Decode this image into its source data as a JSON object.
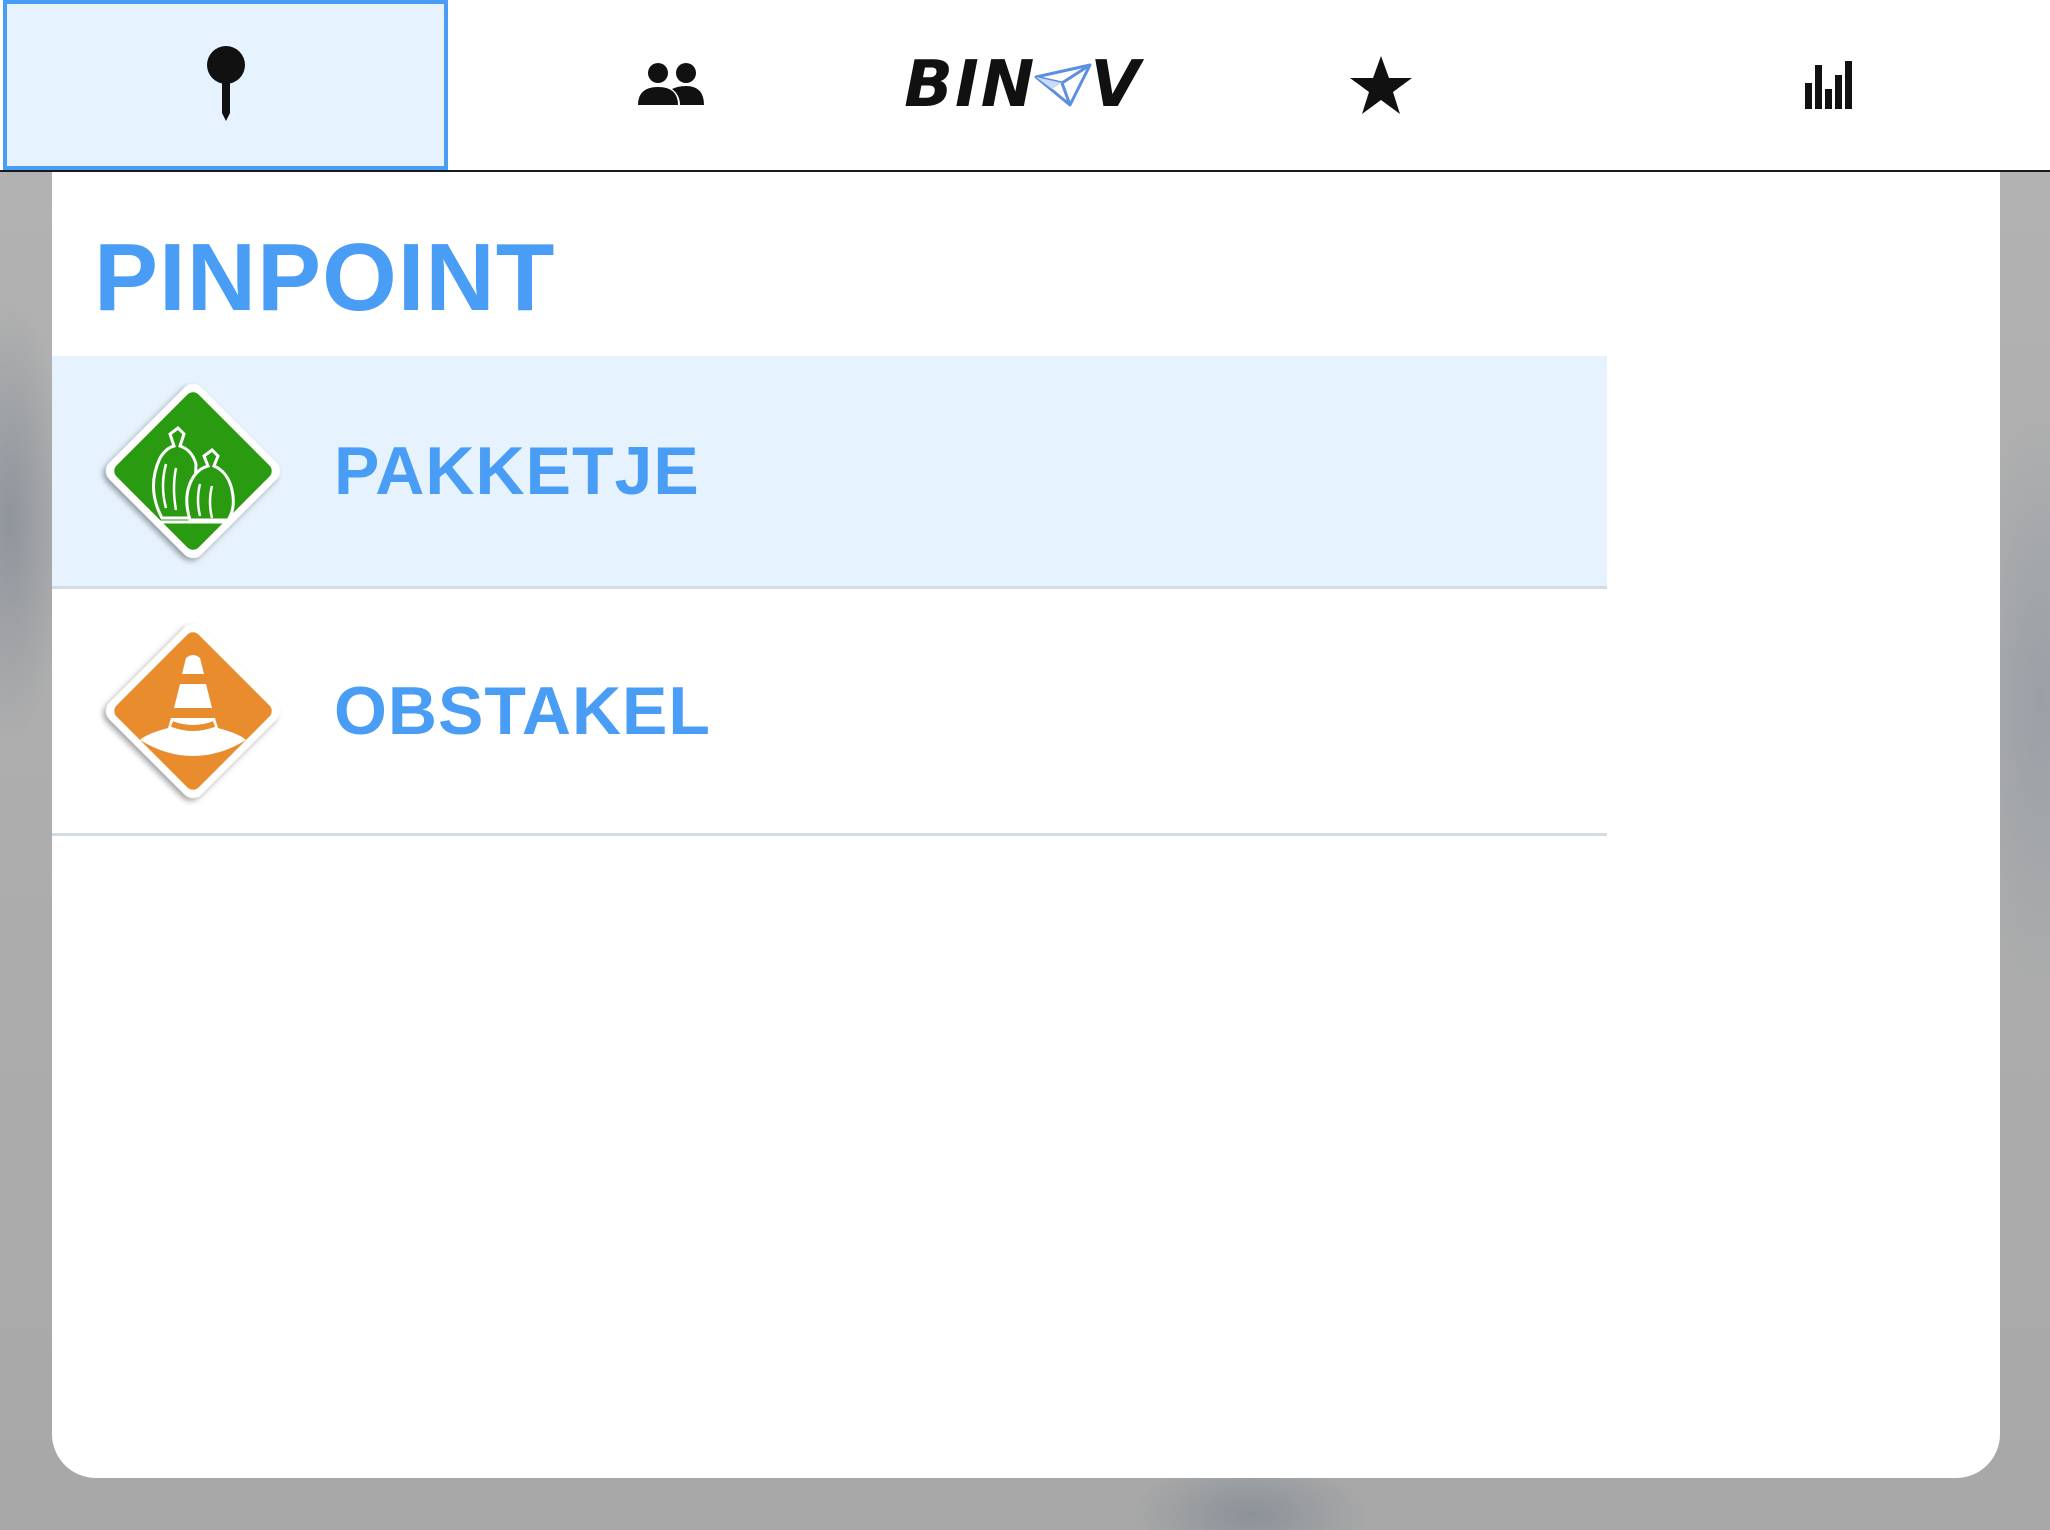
{
  "app": {
    "logo_text_left": "BIN",
    "logo_text_right": "V"
  },
  "toolbar": {
    "tabs": [
      {
        "name": "pinpoint",
        "icon": "pin-icon",
        "active": true
      },
      {
        "name": "users",
        "icon": "people-icon",
        "active": false
      },
      {
        "name": "home",
        "icon": "logo",
        "active": false
      },
      {
        "name": "favorites",
        "icon": "star-icon",
        "active": false
      },
      {
        "name": "statistics",
        "icon": "bar-chart-icon",
        "active": false
      }
    ]
  },
  "panel": {
    "title": "PINPOINT",
    "items": [
      {
        "label": "PAKKETJE",
        "icon": "garbage-bags-icon",
        "color": "#2a9a10",
        "selected": true
      },
      {
        "label": "OBSTAKEL",
        "icon": "traffic-cone-icon",
        "color": "#e88c2e",
        "selected": false
      }
    ]
  },
  "colors": {
    "accent": "#4a9df5",
    "selected_bg": "#e6f2fd"
  }
}
